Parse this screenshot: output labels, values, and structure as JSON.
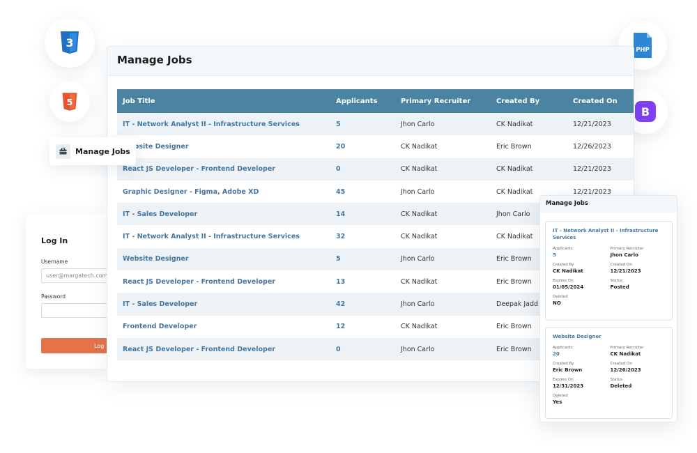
{
  "main": {
    "title": "Manage Jobs",
    "columns": [
      "Job Title",
      "Applicants",
      "Primary Recruiter",
      "Created By",
      "Created On"
    ],
    "rows": [
      [
        "IT - Network Analyst II - Infrastructure Services",
        "5",
        "Jhon Carlo",
        "CK Nadikat",
        "12/21/2023"
      ],
      [
        "Website Designer",
        "20",
        "CK Nadikat",
        "Eric Brown",
        "12/26/2023"
      ],
      [
        "React JS Developer - Frontend Developer",
        "0",
        "CK Nadikat",
        "CK Nadikat",
        "12/21/2023"
      ],
      [
        "Graphic Designer - Figma, Adobe XD",
        "45",
        "Jhon Carlo",
        "CK Nadikat",
        "12/21/2023"
      ],
      [
        "IT - Sales Developer",
        "14",
        "CK Nadikat",
        "Jhon Carlo",
        ""
      ],
      [
        "IT - Network Analyst II - Infrastructure Services",
        "32",
        "CK Nadikat",
        "CK Nadikat",
        ""
      ],
      [
        "Website Designer",
        "5",
        "Jhon Carlo",
        "Eric Brown",
        ""
      ],
      [
        "React JS Developer - Frontend Developer",
        "13",
        "CK Nadikat",
        "Eric Brown",
        ""
      ],
      [
        "IT - Sales Developer",
        "42",
        "Jhon Carlo",
        "Deepak Jadd",
        ""
      ],
      [
        "Frontend Developer",
        "12",
        "CK Nadikat",
        "Eric Brown",
        ""
      ],
      [
        "React JS Developer - Frontend Developer",
        "0",
        "Jhon Carlo",
        "Eric Brown",
        ""
      ]
    ]
  },
  "chip": {
    "label": "Manage Jobs",
    "icon": "briefcase-icon"
  },
  "login": {
    "title": "Log In",
    "username_label": "Username",
    "username_placeholder": "user@margatech.com",
    "password_label": "Password",
    "button_label": "Log"
  },
  "mobile": {
    "title": "Manage Jobs",
    "cards": [
      {
        "title": "IT - Network Analyst II - Infrastructure Services",
        "fields": [
          {
            "label": "Applicants",
            "value": "5"
          },
          {
            "label": "Primary Recruiter",
            "value": "Jhon Carlo"
          },
          {
            "label": "Created By",
            "value": "CK Nadikat"
          },
          {
            "label": "Created On",
            "value": "12/21/2023"
          },
          {
            "label": "Expires On",
            "value": "01/05/2024"
          },
          {
            "label": "Status",
            "value": "Posted"
          },
          {
            "label": "Deleted",
            "value": "NO"
          }
        ]
      },
      {
        "title": "Website Designer",
        "fields": [
          {
            "label": "Applicants",
            "value": "20"
          },
          {
            "label": "Primary Recruiter",
            "value": "CK Nadikat"
          },
          {
            "label": "Created By",
            "value": "Eric Brown"
          },
          {
            "label": "Created On",
            "value": "12/26/2023"
          },
          {
            "label": "Expires On",
            "value": "12/31/2023"
          },
          {
            "label": "Status",
            "value": "Deleted"
          },
          {
            "label": "Deleted",
            "value": "Yes"
          }
        ]
      }
    ]
  },
  "badges": {
    "css": {
      "icon": "css3-icon",
      "text": "3",
      "color": "#1f6fc5"
    },
    "html": {
      "icon": "html5-icon",
      "text": "5",
      "color": "#e5532d"
    },
    "php": {
      "icon": "php-file-icon",
      "text": "PHP",
      "color": "#2f86d6"
    },
    "bootstrap": {
      "icon": "bootstrap-icon",
      "text": "B",
      "color": "#7f3ff2"
    }
  },
  "colors": {
    "table_header": "#4b84a3",
    "row_alt": "#edf2f6",
    "link": "#4677a0",
    "login_button": "#e4734a"
  }
}
